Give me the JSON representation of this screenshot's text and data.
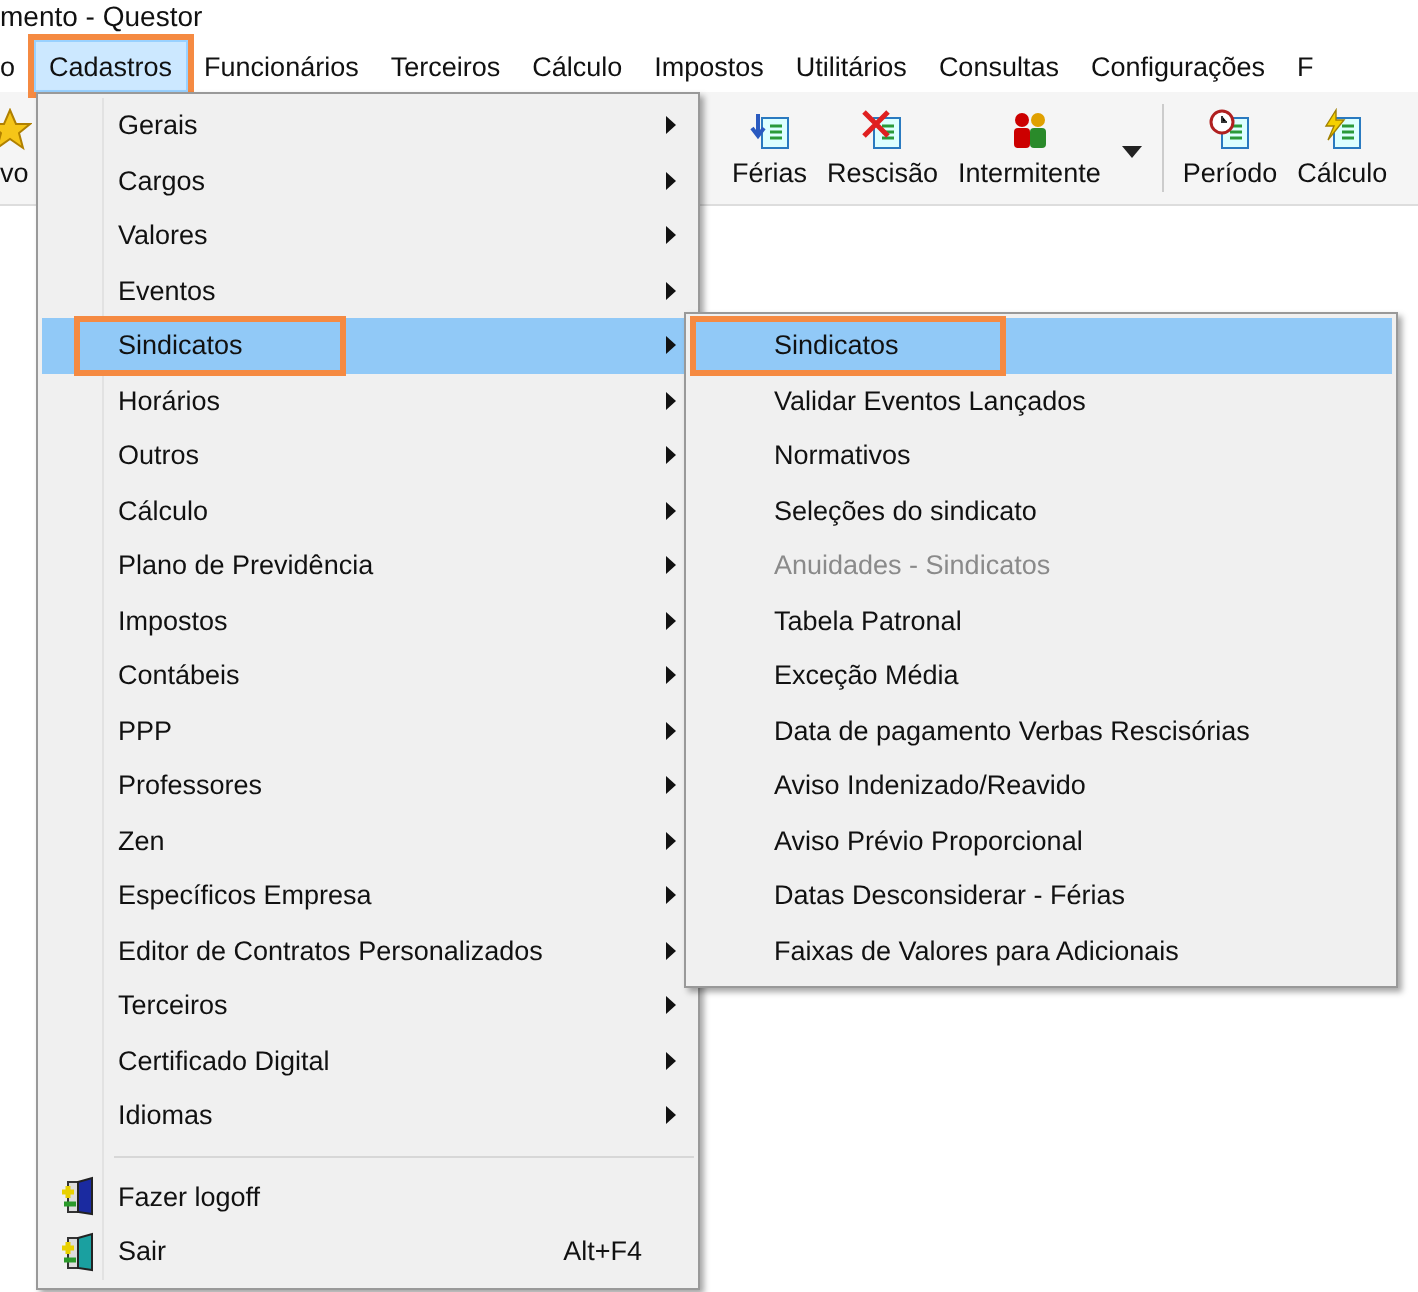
{
  "window": {
    "title": "mento - Questor"
  },
  "menubar": [
    {
      "label": "o",
      "selected": false,
      "highlighted": false
    },
    {
      "label": "Cadastros",
      "selected": true,
      "highlighted": true
    },
    {
      "label": "Funcionários",
      "selected": false,
      "highlighted": false
    },
    {
      "label": "Terceiros",
      "selected": false,
      "highlighted": false
    },
    {
      "label": "Cálculo",
      "selected": false,
      "highlighted": false
    },
    {
      "label": "Impostos",
      "selected": false,
      "highlighted": false
    },
    {
      "label": "Utilitários",
      "selected": false,
      "highlighted": false
    },
    {
      "label": "Consultas",
      "selected": false,
      "highlighted": false
    },
    {
      "label": "Configurações",
      "selected": false,
      "highlighted": false
    },
    {
      "label": "F",
      "selected": false,
      "highlighted": false
    }
  ],
  "toolbar": [
    {
      "label": "vo",
      "kind": "star"
    },
    {
      "label": "Férias",
      "kind": "vacation"
    },
    {
      "label": "Rescisão",
      "kind": "termination"
    },
    {
      "label": "Intermitente",
      "kind": "intermittent"
    },
    {
      "kind": "dropdown"
    },
    {
      "kind": "separator"
    },
    {
      "label": "Período",
      "kind": "period"
    },
    {
      "label": "Cálculo",
      "kind": "calc"
    }
  ],
  "menu": {
    "items": [
      {
        "label": "Gerais",
        "kind": "submenu",
        "selected": false,
        "highlighted": false
      },
      {
        "label": "Cargos",
        "kind": "submenu",
        "selected": false,
        "highlighted": false
      },
      {
        "label": "Valores",
        "kind": "submenu",
        "selected": false,
        "highlighted": false
      },
      {
        "label": "Eventos",
        "kind": "submenu",
        "selected": false,
        "highlighted": false
      },
      {
        "label": "Sindicatos",
        "kind": "submenu",
        "selected": true,
        "highlighted": true
      },
      {
        "label": "Horários",
        "kind": "submenu",
        "selected": false,
        "highlighted": false
      },
      {
        "label": "Outros",
        "kind": "submenu",
        "selected": false,
        "highlighted": false
      },
      {
        "label": "Cálculo",
        "kind": "submenu",
        "selected": false,
        "highlighted": false
      },
      {
        "label": "Plano de Previdência",
        "kind": "submenu",
        "selected": false,
        "highlighted": false
      },
      {
        "label": "Impostos",
        "kind": "submenu",
        "selected": false,
        "highlighted": false
      },
      {
        "label": "Contábeis",
        "kind": "submenu",
        "selected": false,
        "highlighted": false
      },
      {
        "label": "PPP",
        "kind": "submenu",
        "selected": false,
        "highlighted": false
      },
      {
        "label": "Professores",
        "kind": "submenu",
        "selected": false,
        "highlighted": false
      },
      {
        "label": "Zen",
        "kind": "submenu",
        "selected": false,
        "highlighted": false
      },
      {
        "label": "Específicos Empresa",
        "kind": "submenu",
        "selected": false,
        "highlighted": false
      },
      {
        "label": "Editor de Contratos Personalizados",
        "kind": "submenu",
        "selected": false,
        "highlighted": false
      },
      {
        "label": "Terceiros",
        "kind": "submenu",
        "selected": false,
        "highlighted": false
      },
      {
        "label": "Certificado Digital",
        "kind": "submenu",
        "selected": false,
        "highlighted": false
      },
      {
        "label": "Idiomas",
        "kind": "submenu",
        "selected": false,
        "highlighted": false
      },
      {
        "kind": "separator"
      },
      {
        "label": "Fazer logoff",
        "kind": "logoff",
        "selected": false,
        "highlighted": false
      },
      {
        "label": "Sair",
        "kind": "exit",
        "shortcut": "Alt+F4",
        "selected": false,
        "highlighted": false
      }
    ]
  },
  "submenu": {
    "items": [
      {
        "label": "Sindicatos",
        "selected": true,
        "disabled": false,
        "highlighted": true
      },
      {
        "label": "Validar Eventos Lançados",
        "selected": false,
        "disabled": false,
        "highlighted": false
      },
      {
        "label": "Normativos",
        "selected": false,
        "disabled": false,
        "highlighted": false
      },
      {
        "label": "Seleções do sindicato",
        "selected": false,
        "disabled": false,
        "highlighted": false
      },
      {
        "label": "Anuidades - Sindicatos",
        "selected": false,
        "disabled": true,
        "highlighted": false
      },
      {
        "label": "Tabela Patronal",
        "selected": false,
        "disabled": false,
        "highlighted": false
      },
      {
        "label": "Exceção Média",
        "selected": false,
        "disabled": false,
        "highlighted": false
      },
      {
        "label": "Data de pagamento Verbas Rescisórias",
        "selected": false,
        "disabled": false,
        "highlighted": false
      },
      {
        "label": "Aviso Indenizado/Reavido",
        "selected": false,
        "disabled": false,
        "highlighted": false
      },
      {
        "label": "Aviso Prévio Proporcional",
        "selected": false,
        "disabled": false,
        "highlighted": false
      },
      {
        "label": "Datas Desconsiderar - Férias",
        "selected": false,
        "disabled": false,
        "highlighted": false
      },
      {
        "label": "Faixas de Valores para Adicionais",
        "selected": false,
        "disabled": false,
        "highlighted": false
      }
    ]
  }
}
